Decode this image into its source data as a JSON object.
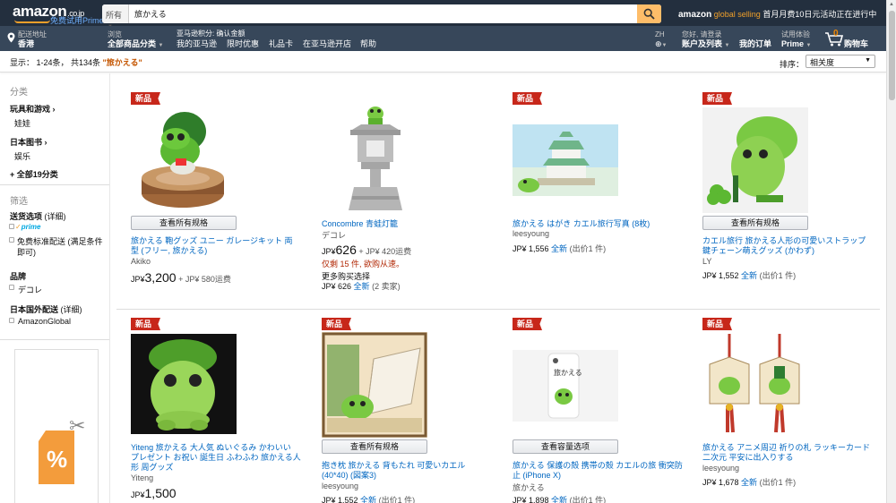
{
  "header": {
    "logo": "amazon",
    "logo_suffix": ".co.jp",
    "logo_prime": "免费试用Prime",
    "search_category": "所有",
    "search_query": "旅かえる",
    "promo_brand": "amazon",
    "promo_brand_sub": "global selling",
    "promo_text": "首月月费10日元活动正在进行中"
  },
  "nav": {
    "deliver_small": "配送地址",
    "deliver_bold": "香港",
    "browse_small": "浏览",
    "browse_bold": "全部商品分类",
    "links_top": "亚马逊积分: 确认金额",
    "links": [
      "我的亚马逊",
      "限时优惠",
      "礼品卡",
      "在亚马逊开店",
      "帮助"
    ],
    "lang": "ZH",
    "account_small": "您好, 请登录",
    "account_bold": "账户及列表",
    "orders": "我的订单",
    "prime_small": "试用体验",
    "prime_bold": "Prime",
    "cart_count": "0",
    "cart_label": "购物车"
  },
  "results": {
    "prefix": "显示： 1-24条，  共134条 ",
    "query": "\"旅かえる\"",
    "sort_label": "排序：",
    "sort_value": "相关度"
  },
  "sidebar": {
    "category_heading": "分类",
    "cat1": "玩具和游戏",
    "cat1_sub": "娃娃",
    "cat2": "日本图书",
    "cat2_sub": "娱乐",
    "all_categories": "+ 全部19分类",
    "filter_heading": "筛选",
    "shipping_heading": "送货选项",
    "shipping_detail": "(详细)",
    "prime_label": "prime",
    "free_ship": "免费标准配送 (满足条件即可)",
    "brand_heading": "品牌",
    "brand_item": "デコレ",
    "intl_heading": "日本国外配送",
    "intl_detail": "(详细)",
    "intl_item": "AmazonGlobal"
  },
  "products": [
    {
      "badge": "新品",
      "button": "查看所有规格",
      "title": "旅かえる 鞄グッズ ユニー ガレージキット 両型 (フリー, 旅かえる)",
      "brand": "Akiko",
      "currency": "JP¥",
      "price": "3,200",
      "shipping": "+ JP¥ 580运费"
    },
    {
      "badge": "",
      "title": "Concombre 青蛙灯籠",
      "brand": "デコレ",
      "currency": "JP¥",
      "price": "626",
      "shipping": "+ JP¥ 420运费",
      "stock": "仅剩 15 件, 欲购从速。",
      "more_label": "更多购买选择",
      "more_price": "JP¥ 626",
      "more_new": "全新",
      "more_offers": "(2 卖家)"
    },
    {
      "badge": "新品",
      "title": "旅かえる はがき カエル旅行写真 (8枚)",
      "brand": "leesyoung",
      "price_line": "JP¥ 1,556",
      "new_label": "全新",
      "offers": "(出价1 件)"
    },
    {
      "badge": "新品",
      "button": "查看所有规格",
      "title": "カエル旅行 旅かえる人形の可愛いストラップ 鍵チェーン萌えグッズ (かわず)",
      "brand": "LY",
      "price_line": "JP¥ 1,552",
      "new_label": "全新",
      "offers": "(出价1 件)"
    },
    {
      "badge": "新品",
      "title": "Yiteng 旅かえる 大人気 ぬいぐるみ かわいい プレゼント お祝い 誕生日 ふわふわ 旅かえる人形 周グッズ",
      "brand": "Yiteng",
      "currency": "JP¥",
      "price": "1,500"
    },
    {
      "badge": "新品",
      "button": "查看所有规格",
      "title": "抱き枕 旅かえる 背もたれ 可愛いカエル (40*40) (図案3)",
      "brand": "leesyoung",
      "price_line": "JP¥ 1,552",
      "new_label": "全新",
      "offers": "(出价1 件)"
    },
    {
      "badge": "新品",
      "button": "查看容量选项",
      "title": "旅かえる 保護の殻 携帯の殻 カエルの旅 衝突防止 (iPhone X)",
      "brand": "旅かえる",
      "price_line": "JP¥ 1,898",
      "new_label": "全新",
      "offers": "(出价1 件)"
    },
    {
      "badge": "新品",
      "title": "旅かえる アニメ周辺 祈りの札 ラッキーカード 二次元 平安に出入りする",
      "brand": "leesyoung",
      "price_line": "JP¥ 1,678",
      "new_label": "全新",
      "offers": "(出价1 件)"
    }
  ],
  "colors": {
    "nav_dark": "#232f3e",
    "nav_light": "#37475a",
    "search_button": "#febd69",
    "badge": "#c7271a",
    "link": "#0066c0"
  }
}
